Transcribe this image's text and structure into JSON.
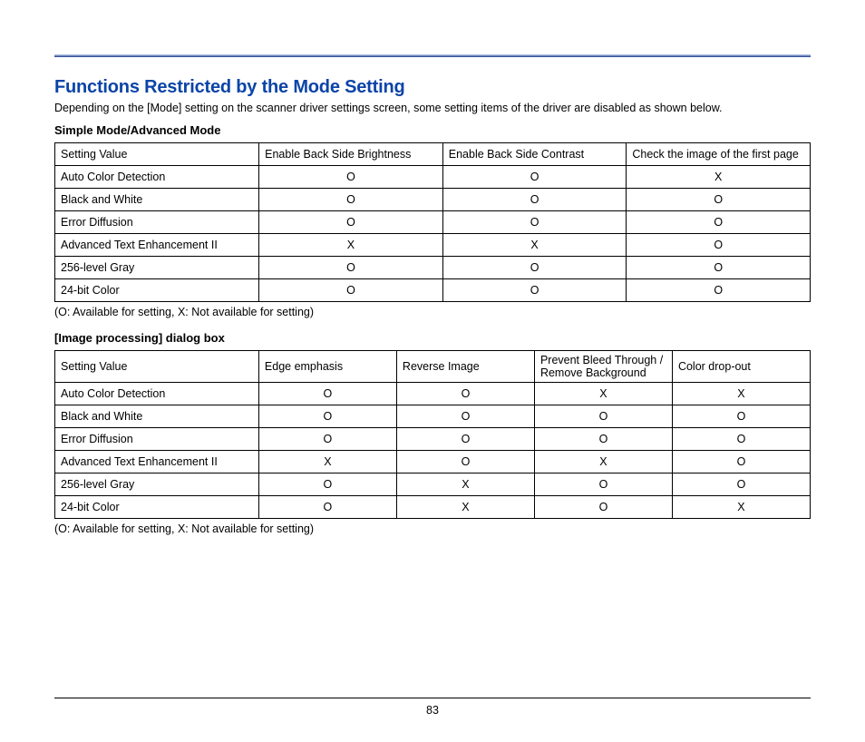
{
  "title": "Functions Restricted by the Mode Setting",
  "intro": "Depending on the [Mode] setting on the scanner driver settings screen, some setting items of the driver are disabled as shown below.",
  "legend": "(O: Available for setting, X: Not available for setting)",
  "page_number": "83",
  "table1": {
    "heading": "Simple Mode/Advanced Mode",
    "cols": [
      "Setting Value",
      "Enable Back Side Brightness",
      "Enable Back Side Contrast",
      "Check the image of the first page"
    ],
    "rows": [
      {
        "label": "Auto Color Detection",
        "v": [
          "O",
          "O",
          "X"
        ]
      },
      {
        "label": "Black and White",
        "v": [
          "O",
          "O",
          "O"
        ]
      },
      {
        "label": "Error Diffusion",
        "v": [
          "O",
          "O",
          "O"
        ]
      },
      {
        "label": "Advanced Text Enhancement II",
        "v": [
          "X",
          "X",
          "O"
        ]
      },
      {
        "label": "256-level Gray",
        "v": [
          "O",
          "O",
          "O"
        ]
      },
      {
        "label": "24-bit Color",
        "v": [
          "O",
          "O",
          "O"
        ]
      }
    ]
  },
  "table2": {
    "heading": "[Image processing] dialog box",
    "cols": [
      "Setting Value",
      "Edge emphasis",
      "Reverse Image",
      "Prevent Bleed Through / Remove Background",
      "Color drop-out"
    ],
    "rows": [
      {
        "label": "Auto Color Detection",
        "v": [
          "O",
          "O",
          "X",
          "X"
        ]
      },
      {
        "label": "Black and White",
        "v": [
          "O",
          "O",
          "O",
          "O"
        ]
      },
      {
        "label": "Error Diffusion",
        "v": [
          "O",
          "O",
          "O",
          "O"
        ]
      },
      {
        "label": "Advanced Text Enhancement II",
        "v": [
          "X",
          "O",
          "X",
          "O"
        ]
      },
      {
        "label": "256-level Gray",
        "v": [
          "O",
          "X",
          "O",
          "O"
        ]
      },
      {
        "label": "24-bit Color",
        "v": [
          "O",
          "X",
          "O",
          "X"
        ]
      }
    ]
  }
}
